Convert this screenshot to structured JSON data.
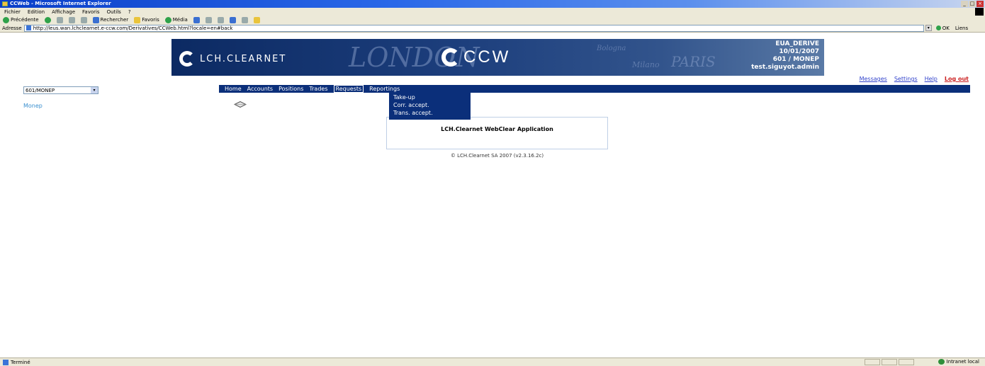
{
  "window": {
    "title": "CCWeb - Microsoft Internet Explorer"
  },
  "menubar": {
    "items": [
      "Fichier",
      "Edition",
      "Affichage",
      "Favoris",
      "Outils",
      "?"
    ]
  },
  "toolbar": {
    "back": "Précédente",
    "search": "Rechercher",
    "favorites": "Favoris",
    "media": "Média"
  },
  "addressbar": {
    "label": "Adresse",
    "url": "http://leus.wan.lchclearnet.e-ccw.com/Derivatives/CCWeb.html?locale=en#back",
    "go": "OK",
    "links": "Liens"
  },
  "banner": {
    "lch_text": "LCH.CLEARNET",
    "ccw_text": "CCW",
    "map_words": [
      "LONDON",
      "PARIS",
      "Milano",
      "Bologna"
    ],
    "info_line1": "EUA_DERIVE",
    "info_line2": "10/01/2007",
    "info_line3": "601 / MONEP",
    "info_line4": "test.siguyot.admin"
  },
  "toplinks": {
    "messages": "Messages",
    "settings": "Settings",
    "help": "Help",
    "logout": "Log out"
  },
  "sidebar": {
    "member_select": "601/MONEP",
    "link": "Monep"
  },
  "nav": {
    "items": [
      "Home",
      "Accounts",
      "Positions",
      "Trades",
      "Requests",
      "Reportings"
    ],
    "active": "Requests"
  },
  "requests_menu": {
    "items": [
      "Take-up",
      "Corr. accept.",
      "Trans. accept."
    ]
  },
  "app": {
    "title": "LCH.Clearnet WebClear Application",
    "copyright": "© LCH.Clearnet SA 2007 (v2.3.16.2c)"
  },
  "statusbar": {
    "left": "Terminé",
    "zone": "Intranet local"
  }
}
